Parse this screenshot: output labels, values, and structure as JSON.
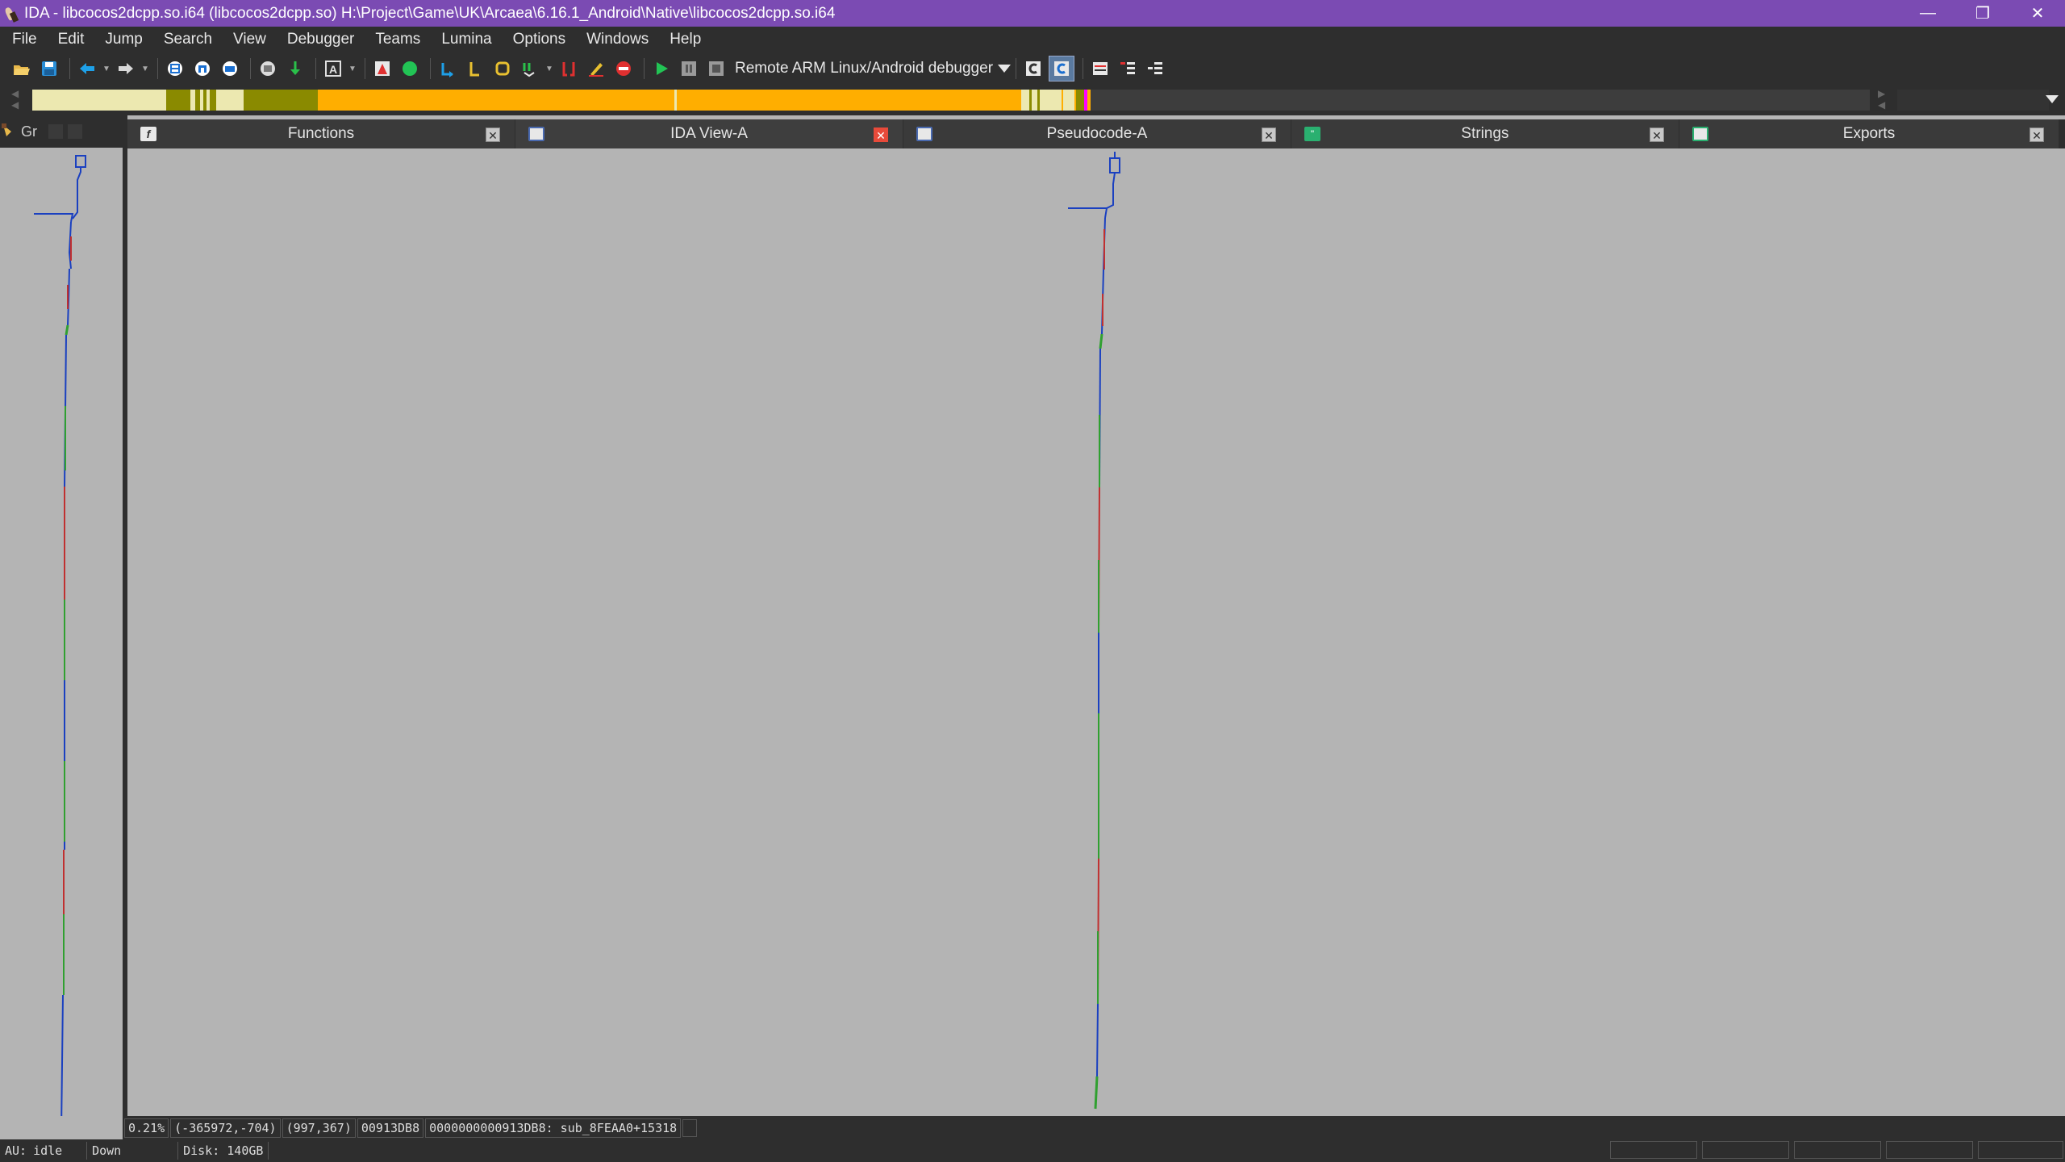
{
  "window": {
    "title": "IDA - libcocos2dcpp.so.i64 (libcocos2dcpp.so) H:\\Project\\Game\\UK\\Arcaea\\6.16.1_Android\\Native\\libcocos2dcpp.so.i64",
    "controls": {
      "minimize": "—",
      "restore": "❐",
      "close": "✕"
    }
  },
  "menu": {
    "items": [
      "File",
      "Edit",
      "Jump",
      "Search",
      "View",
      "Debugger",
      "Teams",
      "Lumina",
      "Options",
      "Windows",
      "Help"
    ]
  },
  "toolbar": {
    "debugger_label": "Remote ARM Linux/Android debugger",
    "icons": [
      "open-icon",
      "save-icon",
      "back-icon",
      "forward-icon",
      "graph-icon",
      "binary-icon",
      "hex-icon",
      "struct-icon",
      "jump-icon",
      "text-icon",
      "mark-icon",
      "color-icon",
      "call-icon",
      "data-icon",
      "code-icon",
      "undefine-icon",
      "breakpoint-icon",
      "edit-icon",
      "stop-icon",
      "play-icon",
      "pause-icon",
      "terminate-icon"
    ]
  },
  "navigator": {
    "colors": {
      "library": "#ece8b0",
      "regular": "#8a8a00",
      "unexplored": "#ffae00",
      "marker": "#ff00ff",
      "empty": "#3d3d3d"
    }
  },
  "left_pane": {
    "title": "Gr"
  },
  "tabs": [
    {
      "label": "Functions",
      "icon": "function-icon",
      "active": false
    },
    {
      "label": "IDA View-A",
      "icon": "ida-view-icon",
      "active": true
    },
    {
      "label": "Pseudocode-A",
      "icon": "pseudocode-icon",
      "active": false
    },
    {
      "label": "Strings",
      "icon": "strings-icon",
      "active": false
    },
    {
      "label": "Exports",
      "icon": "exports-icon",
      "active": false
    }
  ],
  "status": {
    "zoom": "0.21%",
    "graph_coords": "(-365972,-704)",
    "mouse_coords": "(997,367)",
    "file_offset": "00913DB8",
    "location": "0000000000913DB8: sub_8FEAA0+15318",
    "au_label": "AU:",
    "au_state": "idle",
    "direction": "Down",
    "disk": "Disk: 140GB"
  },
  "colors": {
    "titlebar": "#7b4bb3",
    "chrome": "#2e2e2e",
    "canvas": "#b4b4b4",
    "close_active": "#e84a3a"
  }
}
